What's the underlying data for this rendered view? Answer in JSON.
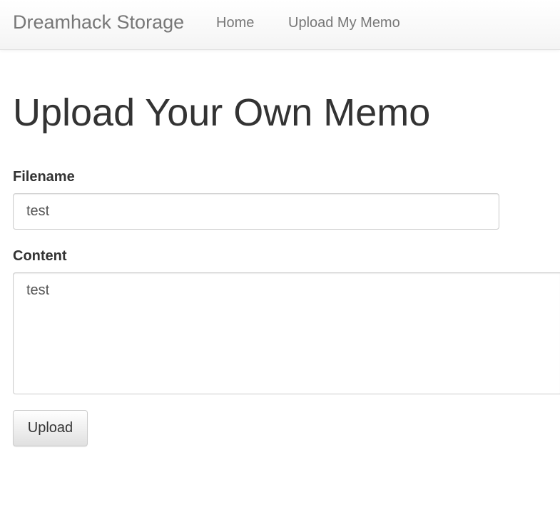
{
  "navbar": {
    "brand": "Dreamhack Storage",
    "links": [
      {
        "label": "Home"
      },
      {
        "label": "Upload My Memo"
      }
    ]
  },
  "main": {
    "title": "Upload Your Own Memo",
    "form": {
      "filename_label": "Filename",
      "filename_value": "test",
      "content_label": "Content",
      "content_value": "test",
      "submit_label": "Upload"
    }
  }
}
